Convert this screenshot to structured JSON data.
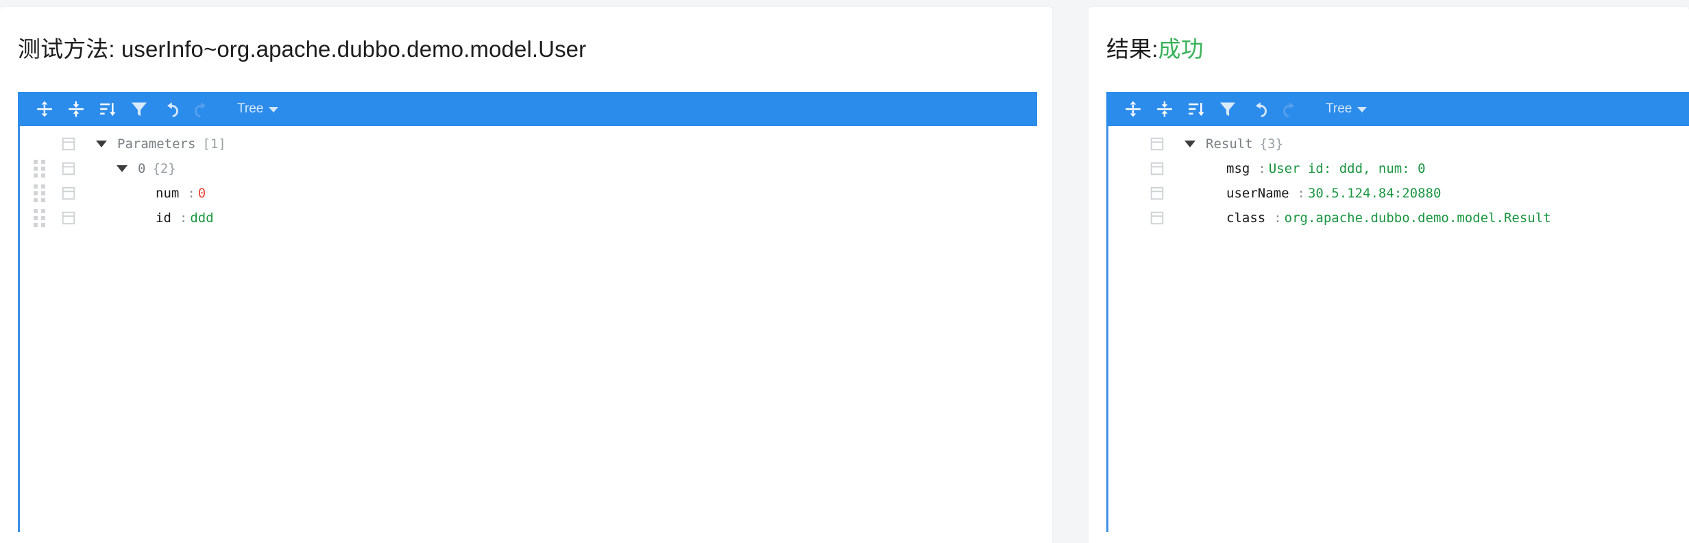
{
  "theme": {
    "toolbar_bg": "#2c8ceb",
    "tree_border": "#3b8fe8",
    "success_green": "#3ab25a",
    "string_green": "#1a9641",
    "number_red": "#e8443a",
    "page_bg": "#f4f5f6"
  },
  "left_panel": {
    "title_prefix": "测试方法: ",
    "title_value": "userInfo~org.apache.dubbo.demo.model.User",
    "toolbar": {
      "expand_all_label": "expand-all",
      "collapse_all_label": "collapse-all",
      "sort_label": "sort",
      "filter_label": "filter",
      "undo_label": "undo",
      "redo_label": "redo",
      "mode_label": "Tree"
    },
    "tree": {
      "rows": [
        {
          "id": "root",
          "has_grip": false,
          "has_expander": true,
          "indent": "indent-1",
          "key": "Parameters",
          "key_muted": true,
          "count": "[1]",
          "separator": "",
          "value": "",
          "value_type": "none"
        },
        {
          "id": "item-0",
          "has_grip": true,
          "has_expander": true,
          "indent": "indent-2",
          "key": "0",
          "key_muted": true,
          "count": "{2}",
          "separator": "",
          "value": "",
          "value_type": "none"
        },
        {
          "id": "num",
          "has_grip": true,
          "has_expander": false,
          "indent": "indent-3",
          "key": "num",
          "key_muted": false,
          "count": "",
          "separator": ":",
          "value": "0",
          "value_type": "number"
        },
        {
          "id": "id",
          "has_grip": true,
          "has_expander": false,
          "indent": "indent-3",
          "key": "id",
          "key_muted": false,
          "count": "",
          "separator": ":",
          "value": "ddd",
          "value_type": "string"
        }
      ]
    }
  },
  "right_panel": {
    "title_prefix": "结果:",
    "title_value": "成功",
    "toolbar": {
      "expand_all_label": "expand-all",
      "collapse_all_label": "collapse-all",
      "sort_label": "sort",
      "filter_label": "filter",
      "undo_label": "undo",
      "redo_label": "redo",
      "mode_label": "Tree"
    },
    "tree": {
      "rows": [
        {
          "id": "root",
          "has_grip": false,
          "has_expander": true,
          "indent": "indent-1",
          "key": "Result",
          "key_muted": true,
          "count": "{3}",
          "separator": "",
          "value": "",
          "value_type": "none"
        },
        {
          "id": "msg",
          "has_grip": false,
          "has_expander": false,
          "indent": "indent-2",
          "key": "msg",
          "key_muted": false,
          "count": "",
          "separator": ":",
          "value": "User id: ddd, num: 0",
          "value_type": "string"
        },
        {
          "id": "userName",
          "has_grip": false,
          "has_expander": false,
          "indent": "indent-2",
          "key": "userName",
          "key_muted": false,
          "count": "",
          "separator": ":",
          "value": "30.5.124.84:20880",
          "value_type": "string"
        },
        {
          "id": "class",
          "has_grip": false,
          "has_expander": false,
          "indent": "indent-2",
          "key": "class",
          "key_muted": false,
          "count": "",
          "separator": ":",
          "value": "org.apache.dubbo.demo.model.Result",
          "value_type": "string"
        }
      ]
    }
  }
}
